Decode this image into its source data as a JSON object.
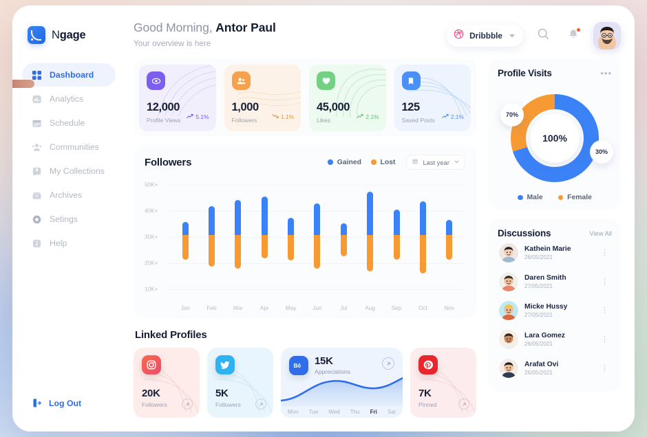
{
  "brand": {
    "name_part1": "N",
    "name_part2": "gage",
    "logo_icon": "broadcast-icon"
  },
  "sidebar": {
    "items": [
      {
        "label": "Dashboard",
        "icon": "grid-icon",
        "active": true
      },
      {
        "label": "Analytics",
        "icon": "bar-chart-icon",
        "active": false
      },
      {
        "label": "Schedule",
        "icon": "calendar-icon",
        "active": false
      },
      {
        "label": "Communities",
        "icon": "people-icon",
        "active": false
      },
      {
        "label": "My Collections",
        "icon": "bookmark-folder-icon",
        "active": false
      },
      {
        "label": "Archives",
        "icon": "archive-box-icon",
        "active": false
      },
      {
        "label": "Setings",
        "icon": "gear-icon",
        "active": false
      },
      {
        "label": "Help",
        "icon": "info-icon",
        "active": false
      }
    ],
    "logout_label": "Log Out",
    "logout_icon": "logout-icon"
  },
  "header": {
    "greeting_prefix": "Good Morning, ",
    "user_name": "Antor Paul",
    "subtitle": "Your overview is here",
    "source_label": "Dribbble",
    "source_icon": "dribbble-icon",
    "search_icon": "search-icon",
    "bell_icon": "bell-icon",
    "has_notification": true,
    "avatar_name": "user-avatar"
  },
  "stats": [
    {
      "value": "12,000",
      "caption": "Profile Views",
      "delta": "5.1%",
      "trend": "up",
      "icon": "eye-icon",
      "icon_bg": "#7d5ff0",
      "card_bg": "#f2effd",
      "delta_color": "#6f5ce8",
      "line_color": "#c9bcf5"
    },
    {
      "value": "1,000",
      "caption": "Followers",
      "delta": "1.1%",
      "trend": "down",
      "icon": "users-icon",
      "icon_bg": "#f5a14e",
      "card_bg": "#fdf2e7",
      "delta_color": "#e2943f",
      "line_color": "#f3d6ae"
    },
    {
      "value": "45,000",
      "caption": "Likes",
      "delta": "2.1%",
      "trend": "up",
      "icon": "heart-icon",
      "icon_bg": "#72d182",
      "card_bg": "#ecfaef",
      "delta_color": "#5fc172",
      "line_color": "#add8b4"
    },
    {
      "value": "125",
      "caption": "Saved Posts",
      "delta": "2.1%",
      "trend": "up",
      "icon": "bookmark-icon",
      "icon_bg": "#4a90f7",
      "card_bg": "#eef4fe",
      "delta_color": "#4a90f7",
      "line_color": "#a7c4f2"
    }
  ],
  "followers_panel": {
    "title": "Followers",
    "legend": [
      {
        "label": "Gained",
        "color": "#3b82f6"
      },
      {
        "label": "Lost",
        "color": "#f79a34"
      }
    ],
    "range_label": "Last year",
    "range_icon": "calendar-icon"
  },
  "chart_data": {
    "type": "bar",
    "title": "Followers",
    "subtitle": "",
    "xlabel": "",
    "ylabel": "",
    "grid": true,
    "legend_position": "top-right",
    "stacked": true,
    "categories": [
      "Jan",
      "Feb",
      "Mar",
      "Apr",
      "May",
      "Jun",
      "Jul",
      "Aug",
      "Sep",
      "Oct",
      "Nov"
    ],
    "ytick_labels": [
      "50K+",
      "40K+",
      "30K+",
      "20K+",
      "10K+"
    ],
    "ytick_values": [
      50000,
      40000,
      30000,
      20000,
      10000
    ],
    "ylim": [
      5000,
      55000
    ],
    "series": [
      {
        "name": "Gained",
        "color": "#3b82f6",
        "values": [
          35500,
          42500,
          45000,
          46500,
          37500,
          43500,
          35000,
          48500,
          41000,
          44500,
          36500
        ]
      },
      {
        "name": "Lost",
        "color": "#f79a34",
        "values": [
          19500,
          16500,
          15500,
          20000,
          19000,
          15500,
          21000,
          14500,
          19500,
          13500,
          19500
        ]
      }
    ],
    "series_note": "Gained = top of bar (upper value on axis); Lost = bottom of bar (lower value on axis); all bars split at ~30K"
  },
  "linked_profiles": {
    "title": "Linked Profiles",
    "cards": [
      {
        "kind": "simple",
        "network": "instagram",
        "icon": "instagram-icon",
        "value": "20K",
        "caption": "Followers",
        "icon_bg": "#f4643f",
        "card_bg": "#fdecea",
        "arrow_icon": "arrow-up-right-icon"
      },
      {
        "kind": "simple",
        "network": "twitter",
        "icon": "twitter-icon",
        "value": "5K",
        "caption": "Followers",
        "icon_bg": "#2fb3f0",
        "card_bg": "#e9f5fd",
        "arrow_icon": "arrow-up-right-icon"
      },
      {
        "kind": "chart",
        "network": "behance",
        "icon": "behance-icon",
        "value": "15K",
        "caption": "Appreciations",
        "icon_bg": "#2f6ee8",
        "card_bg": "#eef4fd",
        "arrow_icon": "arrow-up-right-icon",
        "days": [
          "Mon",
          "Tue",
          "Wed",
          "Thu",
          "Fri",
          "Sat"
        ],
        "active_day": "Fri",
        "chart": {
          "type": "area",
          "x": [
            "Mon",
            "Tue",
            "Wed",
            "Thu",
            "Fri",
            "Sat"
          ],
          "values": [
            8,
            16,
            30,
            26,
            34,
            41
          ],
          "color": "#2f6ee8"
        }
      },
      {
        "kind": "simple",
        "network": "pinterest",
        "icon": "pinterest-icon",
        "value": "7K",
        "caption": "Pinned",
        "icon_bg": "#e8262b",
        "card_bg": "#fdeced",
        "arrow_icon": "arrow-up-right-icon"
      }
    ]
  },
  "profile_visits": {
    "title": "Profile Visits",
    "menu_icon": "more-horizontal-icon",
    "center_label": "100%",
    "segments": [
      {
        "label": "Male",
        "percent": "70%",
        "value": 70,
        "color": "#3b82f6"
      },
      {
        "label": "Female",
        "percent": "30%",
        "value": 30,
        "color": "#f79a34"
      }
    ]
  },
  "profile_visits_chart": {
    "type": "pie",
    "title": "Profile Visits",
    "labels": [
      "Male",
      "Female"
    ],
    "values": [
      70,
      30
    ],
    "colors": [
      "#3b82f6",
      "#f79a34"
    ],
    "center_text": "100%",
    "donut": true,
    "legend_position": "bottom"
  },
  "discussions": {
    "title": "Discussions",
    "view_all_label": "View All",
    "items": [
      {
        "name": "Kathein Marie",
        "date": "28/05/2021",
        "avatar_bg": "#efe7e1",
        "skin": "#f3cfb5",
        "hair": "#2a2220",
        "shirt": "#9fb9cf",
        "menu_icon": "kebab-menu-icon"
      },
      {
        "name": "Daren Smith",
        "date": "27/05/2021",
        "avatar_bg": "#f1efe9",
        "skin": "#eec09a",
        "hair": "#3b2c22",
        "shirt": "#e8866b",
        "menu_icon": "kebab-menu-icon"
      },
      {
        "name": "Micke Hussy",
        "date": "27/05/2021",
        "avatar_bg": "#bfe8f3",
        "skin": "#f0bd94",
        "hair": "#f2c53d",
        "shirt": "#d9683f",
        "menu_icon": "kebab-menu-icon"
      },
      {
        "name": "Lara Gomez",
        "date": "26/05/2021",
        "avatar_bg": "#f6efe8",
        "skin": "#c98a5e",
        "hair": "#35251c",
        "shirt": "#f0f0f0",
        "menu_icon": "kebab-menu-icon"
      },
      {
        "name": "Arafat Ovi",
        "date": "26/05/2021",
        "avatar_bg": "#f4ece9",
        "skin": "#efbf96",
        "hair": "#2b211c",
        "shirt": "#2f3c57",
        "menu_icon": "kebab-menu-icon"
      }
    ]
  }
}
